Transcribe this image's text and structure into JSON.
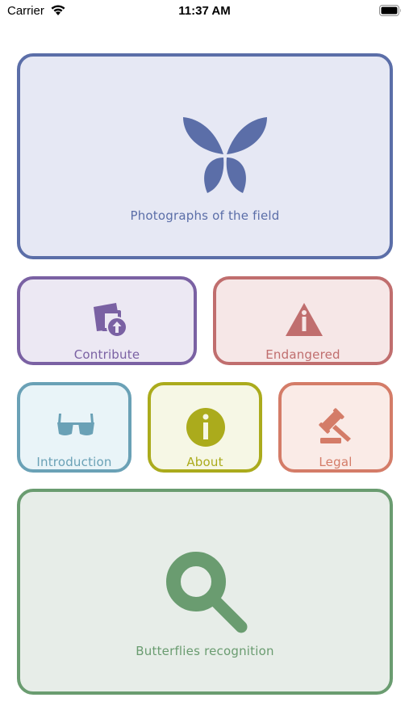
{
  "status_bar": {
    "carrier": "Carrier",
    "time": "11:37 AM",
    "icons": [
      "wifi-icon",
      "battery-icon"
    ]
  },
  "tiles": {
    "photographs": {
      "label": "Photographs of the field",
      "icon": "butterfly-icon",
      "color": "#5b6ea8",
      "bg": "#e6e8f4"
    },
    "contribute": {
      "label": "Contribute",
      "icon": "upload-photo-icon",
      "color": "#7a61a3",
      "bg": "#ece8f3"
    },
    "endangered": {
      "label": "Endangered",
      "icon": "warning-icon",
      "color": "#c06e6e",
      "bg": "#f6e7e7"
    },
    "introduction": {
      "label": "Introduction",
      "icon": "glasses-icon",
      "color": "#6aa1b6",
      "bg": "#e9f4f8"
    },
    "about": {
      "label": "About",
      "icon": "info-icon",
      "color": "#abab1c",
      "bg": "#f6f7e5"
    },
    "legal": {
      "label": "Legal",
      "icon": "gavel-icon",
      "color": "#d47c68",
      "bg": "#faebe7"
    },
    "recognition": {
      "label": "Butterflies recognition",
      "icon": "search-icon",
      "color": "#6a9c70",
      "bg": "#e7ede8"
    }
  }
}
